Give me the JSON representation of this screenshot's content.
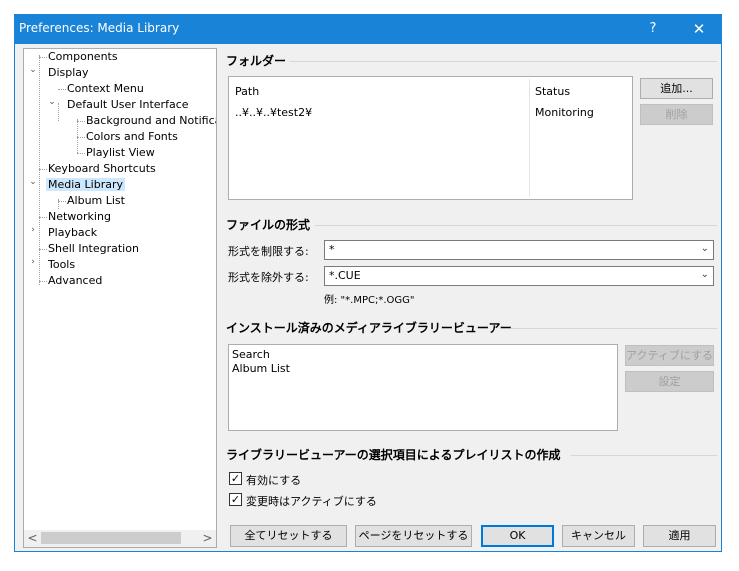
{
  "window": {
    "title": "Preferences: Media Library",
    "help": "?",
    "close": "✕"
  },
  "tree": {
    "items": [
      {
        "label": "Components"
      },
      {
        "label": "Display"
      },
      {
        "label": "Context Menu"
      },
      {
        "label": "Default User Interface"
      },
      {
        "label": "Background and Notification"
      },
      {
        "label": "Colors and Fonts"
      },
      {
        "label": "Playlist View"
      },
      {
        "label": "Keyboard Shortcuts"
      },
      {
        "label": "Media Library"
      },
      {
        "label": "Album List"
      },
      {
        "label": "Networking"
      },
      {
        "label": "Playback"
      },
      {
        "label": "Shell Integration"
      },
      {
        "label": "Tools"
      },
      {
        "label": "Advanced"
      }
    ],
    "scroll_left": "<",
    "scroll_right": ">"
  },
  "folders": {
    "title": "フォルダー",
    "col_path": "Path",
    "col_status": "Status",
    "row_path": "..¥..¥..¥test2¥",
    "row_status": "Monitoring",
    "add_label": "追加...",
    "remove_label": "削除"
  },
  "file_types": {
    "title": "ファイルの形式",
    "restrict_label": "形式を制限する:",
    "restrict_value": "*",
    "exclude_label": "形式を除外する:",
    "exclude_value": "*.CUE",
    "example": "例: \"*.MPC;*.OGG\""
  },
  "viewers": {
    "title": "インストール済みのメディアライブラリービューアー",
    "items": [
      "Search",
      "Album List"
    ],
    "activate_label": "アクティブにする",
    "settings_label": "設定"
  },
  "playlist": {
    "title": "ライブラリービューアーの選択項目によるプレイリストの作成",
    "enable_label": "有効にする",
    "enable_checked": "✓",
    "change_label": "変更時はアクティブにする",
    "change_checked": "✓"
  },
  "buttons": {
    "reset_all": "全てリセットする",
    "reset_page": "ページをリセットする",
    "ok": "OK",
    "cancel": "キャンセル",
    "apply": "適用"
  }
}
